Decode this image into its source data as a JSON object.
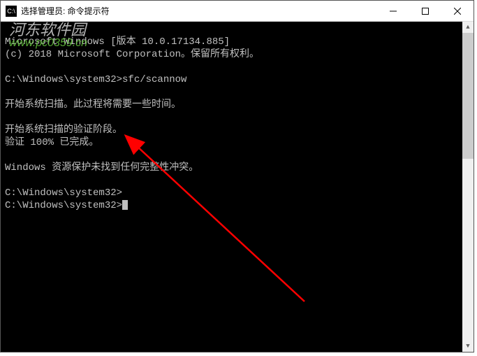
{
  "titlebar": {
    "icon_label": "C:\\",
    "title": "选择管理员: 命令提示符"
  },
  "window_controls": {
    "minimize": "minimize",
    "maximize": "maximize",
    "close": "close"
  },
  "terminal": {
    "line1": "Microsoft Windows [版本 10.0.17134.885]",
    "line2": "(c) 2018 Microsoft Corporation。保留所有权利。",
    "line3": "",
    "line4": "C:\\Windows\\system32>sfc/scannow",
    "line5": "",
    "line6": "开始系统扫描。此过程将需要一些时间。",
    "line7": "",
    "line8": "开始系统扫描的验证阶段。",
    "line9": "验证 100% 已完成。",
    "line10": "",
    "line11": "Windows 资源保护未找到任何完整性冲突。",
    "line12": "",
    "line13": "C:\\Windows\\system32>",
    "line14": "C:\\Windows\\system32>"
  },
  "watermark": {
    "text_cn": "河东软件园",
    "text_url": "www.pc0359.cn"
  },
  "scrollbar": {
    "up": "▲",
    "down": "▼"
  }
}
